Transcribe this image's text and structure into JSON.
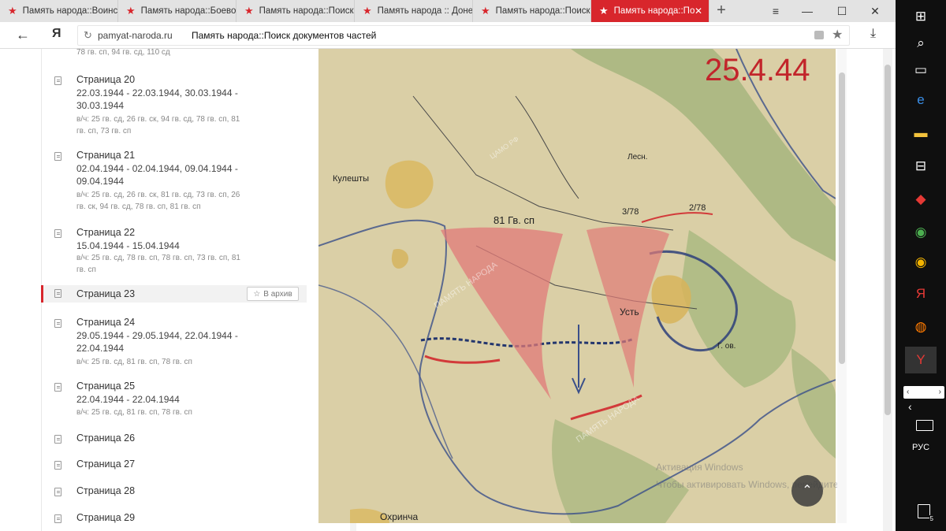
{
  "tabs": [
    {
      "title": "Память народа::Воинс"
    },
    {
      "title": "Память народа::Боево"
    },
    {
      "title": "Память народа::Поиск"
    },
    {
      "title": "Память народа :: Доне"
    },
    {
      "title": "Память народа::Поиск"
    },
    {
      "title": "Память народа::Поиск"
    }
  ],
  "icons": {
    "tab": "star-icon",
    "close": "close-icon",
    "new_tab": "plus-icon",
    "back": "arrow-left-icon",
    "browser": "yandex-icon",
    "reload": "reload-icon",
    "lock": "lock-icon",
    "bookmark": "star-icon",
    "download": "download-icon",
    "document": "document-icon",
    "up": "chevron-up-icon"
  },
  "address": {
    "domain": "pamyat-naroda.ru",
    "title": "Память народа::Поиск документов частей"
  },
  "list": {
    "prev_tail": "78 гв. сп, 94 гв. сд, 110 сд",
    "archive_label": "В архив",
    "items": [
      {
        "name": "Страница 20",
        "dates": "22.03.1944 - 22.03.1944, 30.03.1944 - 30.03.1944",
        "units": "в/ч: 25 гв. сд, 26 гв. ск, 94 гв. сд, 78 гв. сп, 81 гв. сп, 73 гв. сп"
      },
      {
        "name": "Страница 21",
        "dates": "02.04.1944 - 02.04.1944, 09.04.1944 - 09.04.1944",
        "units": "в/ч: 25 гв. сд, 26 гв. ск, 81 гв. сд, 73 гв. сп, 26 гв. ск, 94 гв. сд, 78 гв. сп, 81 гв. сп"
      },
      {
        "name": "Страница 22",
        "dates": "15.04.1944 - 15.04.1944",
        "units": "в/ч: 25 гв. сд, 78 гв. сп, 78 гв. сп, 73 гв. сп, 81 гв. сп"
      },
      {
        "name": "Страница 23",
        "dates": "",
        "units": ""
      },
      {
        "name": "Страница 24",
        "dates": "29.05.1944 - 29.05.1944, 22.04.1944 - 22.04.1944",
        "units": "в/ч: 25 гв. сд, 81 гв. сп, 78 гв. сп"
      },
      {
        "name": "Страница 25",
        "dates": "22.04.1944 - 22.04.1944",
        "units": "в/ч: 25 гв. сд, 81 гв. сп, 78 гв. сп"
      },
      {
        "name": "Страница 26",
        "dates": "",
        "units": ""
      },
      {
        "name": "Страница 27",
        "dates": "",
        "units": ""
      },
      {
        "name": "Страница 28",
        "dates": "",
        "units": ""
      },
      {
        "name": "Страница 29",
        "dates": "",
        "units": ""
      }
    ]
  },
  "map": {
    "date_stamp": "25.4.44",
    "labels": {
      "unit": "81 Гв. сп",
      "town": "Усть",
      "village": "Охринча",
      "kuleshty": "Кулешты",
      "forest": "Лесн.",
      "mark_378": "3/78",
      "mark_278": "2/78",
      "gv": "Г. ов."
    },
    "watermark": "ПАМЯТЬ НАРОДА",
    "archive_mark": "ЦАМО РФ"
  },
  "watermark_os": {
    "line1": "Активация Windows",
    "line2": "Чтобы активировать Windows, перейдите в"
  },
  "taskbar": {
    "lang": "РУС",
    "notif_count": "5",
    "icons": [
      "windows-icon",
      "search-icon",
      "task-view-icon",
      "edge-icon",
      "explorer-icon",
      "store-icon",
      "app-icon",
      "chrome-icon",
      "chrome-canary-icon",
      "yandex-icon",
      "firefox-icon",
      "yandex-browser-icon"
    ]
  },
  "colors": {
    "accent": "#d8262c",
    "map_paper": "#dacfa6",
    "taskbar": "#0f0f0f"
  }
}
